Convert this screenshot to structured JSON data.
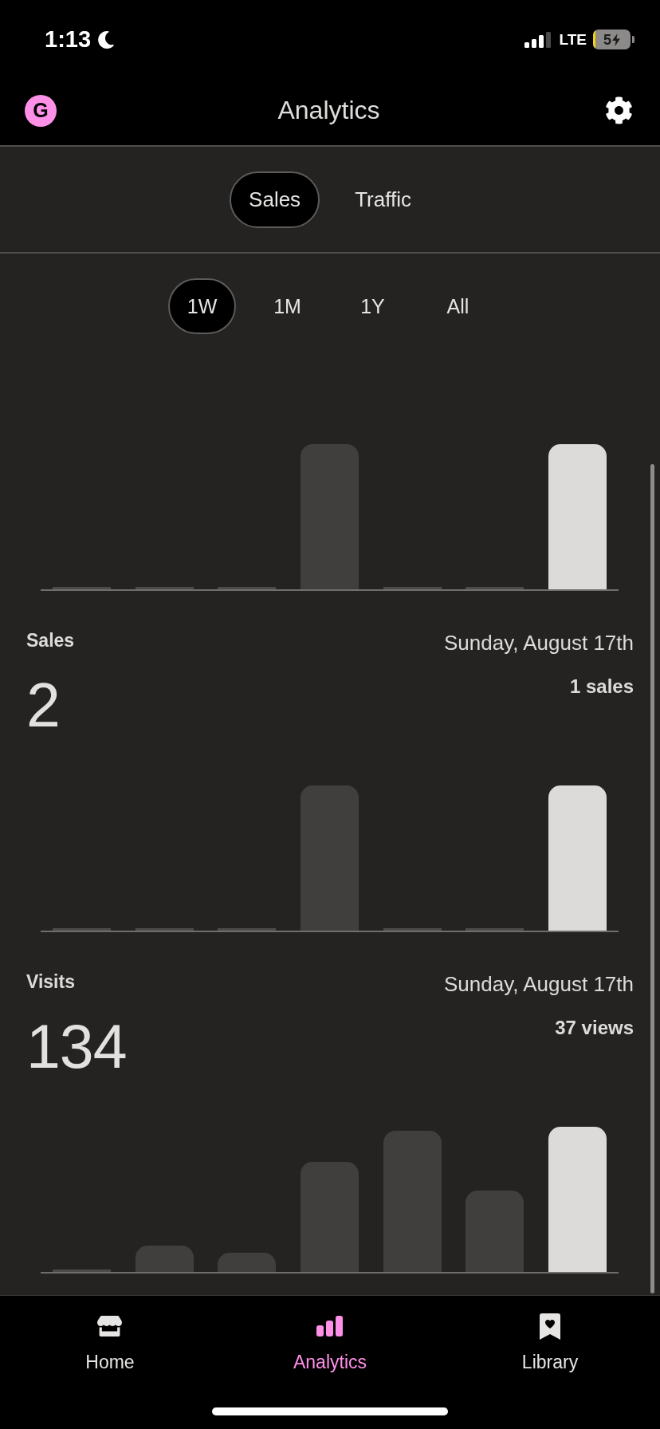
{
  "status_bar": {
    "time": "1:13",
    "focus_mode": true,
    "network": "LTE",
    "battery_text": "5",
    "charging": true
  },
  "header": {
    "logo_letter": "G",
    "title": "Analytics"
  },
  "tabs": [
    {
      "label": "Sales",
      "selected": true
    },
    {
      "label": "Traffic",
      "selected": false
    }
  ],
  "periods": [
    {
      "label": "1W",
      "selected": true
    },
    {
      "label": "1M",
      "selected": false
    },
    {
      "label": "1Y",
      "selected": false
    },
    {
      "label": "All",
      "selected": false
    }
  ],
  "revenue_chart": {
    "bars": [
      {
        "selected": false
      },
      {
        "selected": false
      },
      {
        "selected": false
      },
      {
        "selected": false
      },
      {
        "selected": false
      },
      {
        "selected": false
      },
      {
        "selected": true
      }
    ]
  },
  "sections": [
    {
      "label": "Sales",
      "value": "2",
      "date": "Sunday, August 17th",
      "day_total": "1 sales",
      "bars": [
        {
          "selected": false
        },
        {
          "selected": false
        },
        {
          "selected": false
        },
        {
          "selected": false
        },
        {
          "selected": false
        },
        {
          "selected": false
        },
        {
          "selected": true
        }
      ]
    },
    {
      "label": "Visits",
      "value": "134",
      "date": "Sunday, August 17th",
      "day_total": "37 views",
      "bars": [
        {
          "selected": false
        },
        {
          "selected": false
        },
        {
          "selected": false
        },
        {
          "selected": false
        },
        {
          "selected": false
        },
        {
          "selected": false
        },
        {
          "selected": true
        }
      ]
    }
  ],
  "bottom_nav": [
    {
      "label": "Home",
      "kind": "store",
      "selected": false
    },
    {
      "label": "Analytics",
      "kind": "chart",
      "selected": true
    },
    {
      "label": "Library",
      "kind": "bookmark",
      "selected": false
    }
  ]
}
